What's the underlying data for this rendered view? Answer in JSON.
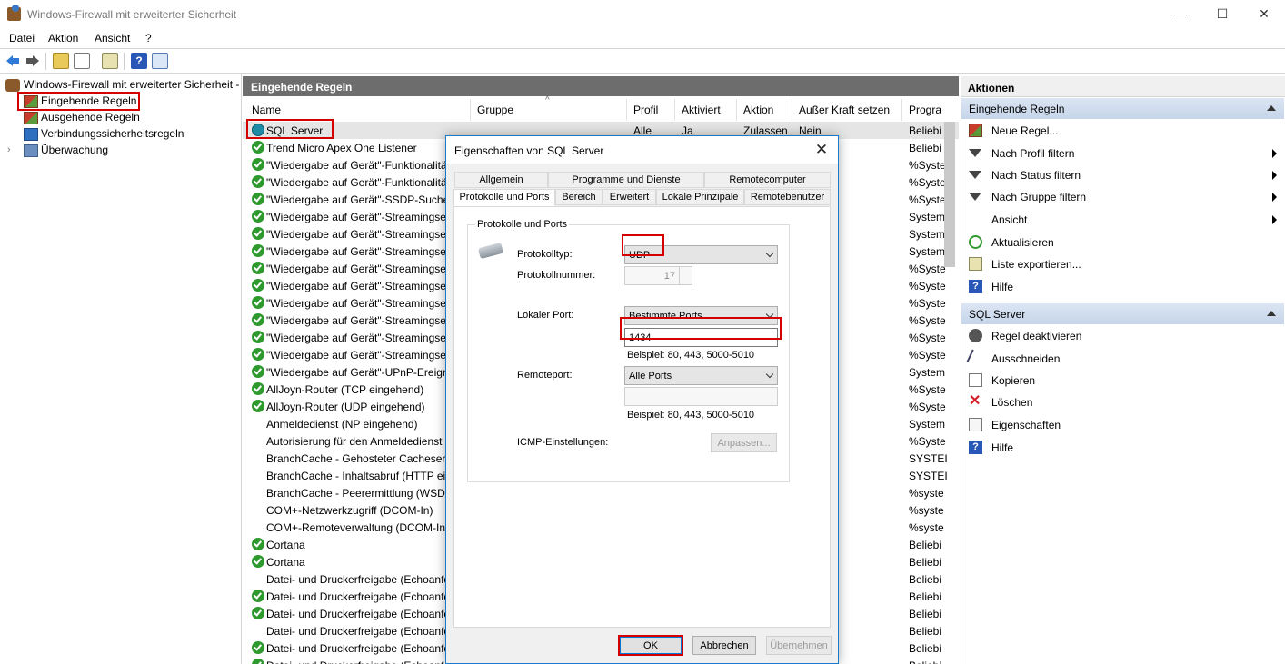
{
  "window": {
    "title": "Windows-Firewall mit erweiterter Sicherheit",
    "minimize": "—",
    "maximize": "☐",
    "close": "✕"
  },
  "menu": [
    "Datei",
    "Aktion",
    "Ansicht",
    "?"
  ],
  "tree": {
    "root": "Windows-Firewall mit erweiterter Sicherheit -",
    "items": [
      "Eingehende Regeln",
      "Ausgehende Regeln",
      "Verbindungssicherheitsregeln",
      "Überwachung"
    ]
  },
  "center": {
    "header": "Eingehende Regeln",
    "columns": [
      "Name",
      "Gruppe",
      "Profil",
      "Aktiviert",
      "Aktion",
      "Außer Kraft setzen",
      "Progra"
    ],
    "rows": [
      {
        "name": "SQL Server",
        "icon": "globe",
        "profil": "Alle",
        "aktiviert": "Ja",
        "aktion": "Zulassen",
        "override": "Nein",
        "program": "Beliebi"
      },
      {
        "name": "Trend Micro Apex One Listener",
        "icon": "check",
        "program": "Beliebi"
      },
      {
        "name": "\"Wiedergabe auf Gerät\"-Funktionalitä",
        "icon": "check",
        "program": "%Syste"
      },
      {
        "name": "\"Wiedergabe auf Gerät\"-Funktionalitä",
        "icon": "check",
        "program": "%Syste"
      },
      {
        "name": "\"Wiedergabe auf Gerät\"-SSDP-Suche",
        "icon": "check",
        "program": "%Syste"
      },
      {
        "name": "\"Wiedergabe auf Gerät\"-Streamingser",
        "icon": "check",
        "program": "System"
      },
      {
        "name": "\"Wiedergabe auf Gerät\"-Streamingser",
        "icon": "check",
        "program": "System"
      },
      {
        "name": "\"Wiedergabe auf Gerät\"-Streamingser",
        "icon": "check",
        "program": "System"
      },
      {
        "name": "\"Wiedergabe auf Gerät\"-Streamingser",
        "icon": "check",
        "program": "%Syste"
      },
      {
        "name": "\"Wiedergabe auf Gerät\"-Streamingser",
        "icon": "check",
        "program": "%Syste"
      },
      {
        "name": "\"Wiedergabe auf Gerät\"-Streamingser",
        "icon": "check",
        "program": "%Syste"
      },
      {
        "name": "\"Wiedergabe auf Gerät\"-Streamingser",
        "icon": "check",
        "program": "%Syste"
      },
      {
        "name": "\"Wiedergabe auf Gerät\"-Streamingser",
        "icon": "check",
        "program": "%Syste"
      },
      {
        "name": "\"Wiedergabe auf Gerät\"-Streamingser",
        "icon": "check",
        "program": "%Syste"
      },
      {
        "name": "\"Wiedergabe auf Gerät\"-UPnP-Ereign",
        "icon": "check",
        "program": "System"
      },
      {
        "name": "AllJoyn-Router (TCP eingehend)",
        "icon": "check",
        "program": "%Syste"
      },
      {
        "name": "AllJoyn-Router (UDP eingehend)",
        "icon": "check",
        "program": "%Syste"
      },
      {
        "name": "Anmeldedienst (NP eingehend)",
        "icon": "none",
        "program": "System"
      },
      {
        "name": "Autorisierung für den Anmeldedienst",
        "icon": "none",
        "program": "%Syste"
      },
      {
        "name": "BranchCache - Gehosteter Cacheserve",
        "icon": "none",
        "program": "SYSTEI"
      },
      {
        "name": "BranchCache - Inhaltsabruf (HTTP ein",
        "icon": "none",
        "program": "SYSTEI"
      },
      {
        "name": "BranchCache - Peerermittlung (WSD e",
        "icon": "none",
        "program": "%syste"
      },
      {
        "name": "COM+-Netzwerkzugriff (DCOM-In)",
        "icon": "none",
        "program": "%syste"
      },
      {
        "name": "COM+-Remoteverwaltung (DCOM-In)",
        "icon": "none",
        "program": "%syste"
      },
      {
        "name": "Cortana",
        "icon": "check",
        "program": "Beliebi"
      },
      {
        "name": "Cortana",
        "icon": "check",
        "program": "Beliebi"
      },
      {
        "name": "Datei- und Druckerfreigabe (Echoanfo",
        "icon": "none",
        "program": "Beliebi"
      },
      {
        "name": "Datei- und Druckerfreigabe (Echoanfo",
        "icon": "check",
        "program": "Beliebi"
      },
      {
        "name": "Datei- und Druckerfreigabe (Echoanfo",
        "icon": "check",
        "program": "Beliebi"
      },
      {
        "name": "Datei- und Druckerfreigabe (Echoanfo",
        "icon": "none",
        "program": "Beliebi"
      },
      {
        "name": "Datei- und Druckerfreigabe (Echoanfo",
        "icon": "check",
        "program": "Beliebi"
      },
      {
        "name": "Datei- und Druckerfreigabe (Echoanfo",
        "icon": "check",
        "program": "Beliebi"
      }
    ]
  },
  "actions": {
    "title": "Aktionen",
    "group1": "Eingehende Regeln",
    "group1_items": [
      {
        "label": "Neue Regel...",
        "icon": "new-rule-icon",
        "submenu": false
      },
      {
        "label": "Nach Profil filtern",
        "icon": "filter-icon",
        "submenu": true
      },
      {
        "label": "Nach Status filtern",
        "icon": "filter-icon",
        "submenu": true
      },
      {
        "label": "Nach Gruppe filtern",
        "icon": "filter-icon",
        "submenu": true
      },
      {
        "label": "Ansicht",
        "icon": "",
        "submenu": true
      },
      {
        "label": "Aktualisieren",
        "icon": "refresh-icon",
        "submenu": false
      },
      {
        "label": "Liste exportieren...",
        "icon": "export-icon",
        "submenu": false
      },
      {
        "label": "Hilfe",
        "icon": "help-icon",
        "submenu": false
      }
    ],
    "group2": "SQL Server",
    "group2_items": [
      {
        "label": "Regel deaktivieren",
        "icon": "disable-icon"
      },
      {
        "label": "Ausschneiden",
        "icon": "cut-icon"
      },
      {
        "label": "Kopieren",
        "icon": "copy-icon"
      },
      {
        "label": "Löschen",
        "icon": "delete-icon"
      },
      {
        "label": "Eigenschaften",
        "icon": "properties-icon"
      },
      {
        "label": "Hilfe",
        "icon": "help-icon"
      }
    ]
  },
  "dialog": {
    "title": "Eigenschaften von SQL Server",
    "tabs_row1": [
      "Allgemein",
      "Programme und Dienste",
      "Remotecomputer"
    ],
    "tabs_row2": [
      "Protokolle und Ports",
      "Bereich",
      "Erweitert",
      "Lokale Prinzipale",
      "Remotebenutzer"
    ],
    "group_title": "Protokolle und Ports",
    "protocol_type_label": "Protokolltyp:",
    "protocol_type_value": "UDP",
    "protocol_number_label": "Protokollnummer:",
    "protocol_number_value": "17",
    "local_port_label": "Lokaler Port:",
    "local_port_mode": "Bestimmte Ports",
    "local_port_value": "1434",
    "example1": "Beispiel: 80, 443, 5000-5010",
    "remote_port_label": "Remoteport:",
    "remote_port_mode": "Alle Ports",
    "remote_port_value": "",
    "example2": "Beispiel: 80, 443, 5000-5010",
    "icmp_label": "ICMP-Einstellungen:",
    "customize_button": "Anpassen...",
    "ok": "OK",
    "cancel": "Abbrechen",
    "apply": "Übernehmen"
  },
  "colors": {
    "highlight": "#d40000",
    "accent": "#0078d7",
    "pane_header": "#6d6d6d"
  }
}
